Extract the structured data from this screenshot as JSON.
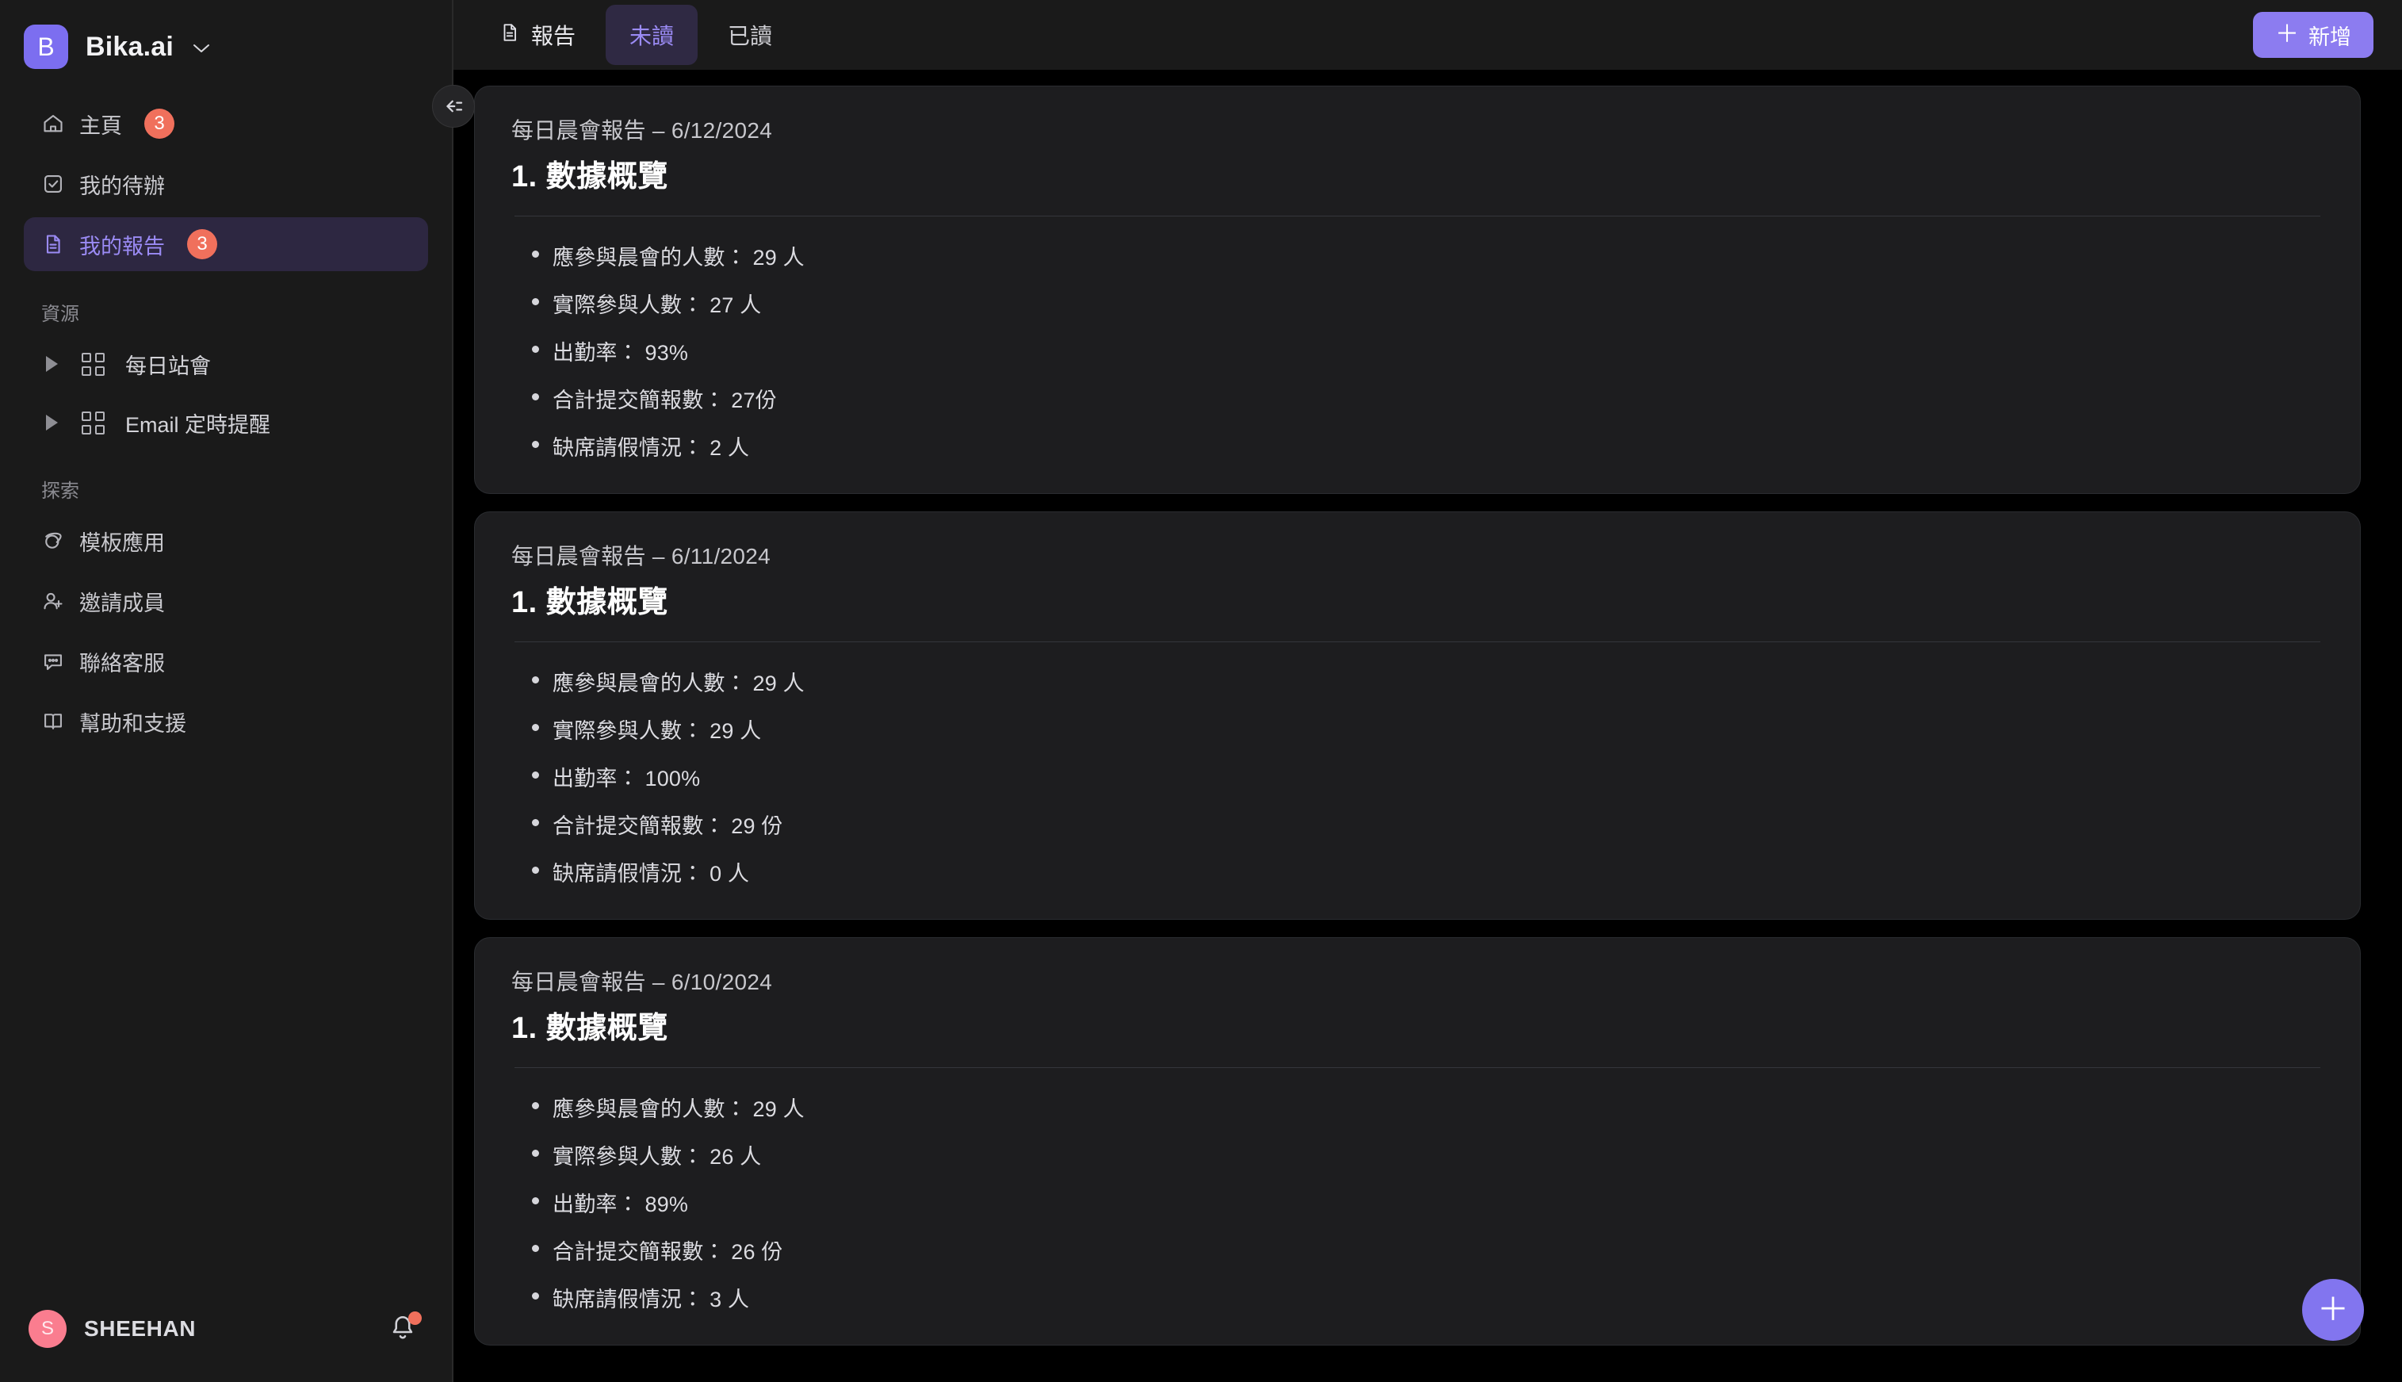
{
  "brand": {
    "logo_letter": "B",
    "name": "Bika.ai",
    "caret": "⌄",
    "logo_color": "#7c6ef0"
  },
  "sidebar": {
    "nav": [
      {
        "label": "主頁",
        "icon": "home-icon",
        "badge": "3",
        "active": false
      },
      {
        "label": "我的待辦",
        "icon": "checkbox-icon",
        "badge": "",
        "active": false
      },
      {
        "label": "我的報告",
        "icon": "document-icon",
        "badge": "3",
        "active": true
      }
    ],
    "resources_label": "資源",
    "resources": [
      {
        "label": "每日站會",
        "icon": "grid-icon",
        "expander": "caret-right-icon"
      },
      {
        "label": "Email 定時提醒",
        "icon": "grid-icon",
        "expander": "caret-right-icon"
      }
    ],
    "explore_label": "探索",
    "explore": [
      {
        "label": "模板應用",
        "icon": "planet-icon"
      },
      {
        "label": "邀請成員",
        "icon": "user-plus-icon"
      },
      {
        "label": "聯絡客服",
        "icon": "chat-icon"
      },
      {
        "label": "幫助和支援",
        "icon": "book-icon"
      }
    ],
    "user": {
      "avatar_letter": "S",
      "name": "SHEEHAN",
      "avatar_color": "#fa7d8f",
      "notification_dot": true
    },
    "collapse_icon": "collapse-sidebar-icon"
  },
  "topbar": {
    "section_icon": "document-icon",
    "section_label": "報告",
    "tabs": [
      {
        "label": "未讀",
        "active": true
      },
      {
        "label": "已讀",
        "active": false
      }
    ],
    "add_button": {
      "plus": "＋",
      "label": "新增"
    },
    "accent_color": "#8c7cf0"
  },
  "reports": [
    {
      "date_line": "每日晨會報告 – 6/12/2024",
      "title": "1. 數據概覽",
      "bullets": [
        "應參與晨會的人數：  29 人",
        "實際參與人數： 27 人",
        "出勤率： 93%",
        "合計提交簡報數： 27份",
        "缺席請假情況： 2 人"
      ]
    },
    {
      "date_line": "每日晨會報告 – 6/11/2024",
      "title": "1. 數據概覽",
      "bullets": [
        "應參與晨會的人數：  29 人",
        "實際參與人數： 29 人",
        "出勤率： 100%",
        "合計提交簡報數： 29 份",
        "缺席請假情況： 0 人"
      ]
    },
    {
      "date_line": "每日晨會報告 – 6/10/2024",
      "title": "1. 數據概覽",
      "bullets": [
        "應參與晨會的人數：  29 人",
        "實際參與人數： 26 人",
        "出勤率： 89%",
        "合計提交簡報數： 26 份",
        "缺席請假情況： 3 人"
      ]
    }
  ],
  "fab": {
    "label": "＋"
  }
}
